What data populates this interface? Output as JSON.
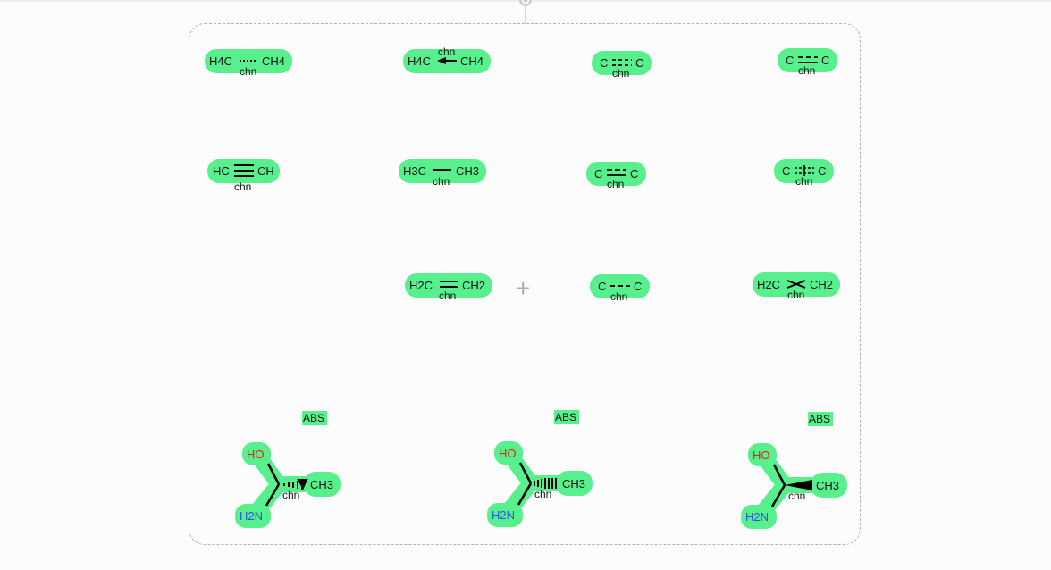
{
  "colors": {
    "highlight": "#58f08c",
    "frame_border": "#aab0c4",
    "hydroxyl": "#e02020",
    "amine": "#2a55e0",
    "bond": "#000000",
    "plus": "#a8aec0"
  },
  "plus_symbol": "+",
  "molecules": [
    {
      "left": "H4C",
      "right": "CH4",
      "chain": "chn",
      "bond": "dotted"
    },
    {
      "left": "H4C",
      "right": "CH4",
      "chain": "chn",
      "bond": "dative"
    },
    {
      "left": "C",
      "right": "C",
      "chain": "chn",
      "bond": "double-dashed"
    },
    {
      "left": "C",
      "right": "C",
      "chain": "chn",
      "bond": "double-dashed-alt"
    },
    {
      "left": "HC",
      "right": "CH",
      "chain": "chn",
      "bond": "triple"
    },
    {
      "left": "H3C",
      "right": "CH3",
      "chain": "chn",
      "bond": "single"
    },
    {
      "left": "C",
      "right": "C",
      "chain": "chn",
      "bond": "aromatic"
    },
    {
      "left": "C",
      "right": "C",
      "chain": "chn",
      "bond": "any"
    },
    {
      "left": "H2C",
      "right": "CH2",
      "chain": "chn",
      "bond": "double"
    },
    {
      "left": "C",
      "right": "C",
      "chain": "chn",
      "bond": "dashed"
    },
    {
      "left": "H2C",
      "right": "CH2",
      "chain": "chn",
      "bond": "crossed-double"
    }
  ],
  "stereo": [
    {
      "abs_label": "ABS",
      "hydroxyl": "HO",
      "amine": "H2N",
      "methyl": "CH3",
      "chain": "chn",
      "wedge": "hashed-wedge"
    },
    {
      "abs_label": "ABS",
      "hydroxyl": "HO",
      "amine": "H2N",
      "methyl": "CH3",
      "chain": "chn",
      "wedge": "hashed"
    },
    {
      "abs_label": "ABS",
      "hydroxyl": "HO",
      "amine": "H2N",
      "methyl": "CH3",
      "chain": "chn",
      "wedge": "solid-wedge"
    }
  ]
}
